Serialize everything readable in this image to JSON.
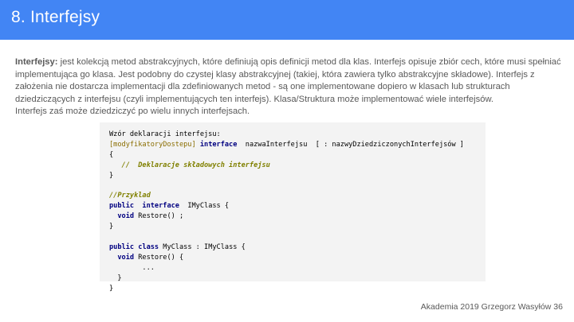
{
  "slide": {
    "title": "8. Interfejsy",
    "paragraph": {
      "term": "Interfejsy:",
      "line1": " jest kolekcją metod abstrakcyjnych, które definiują opis definicji metod dla klas. Interfejs opisuje zbiór cech, które musi spełniać",
      "line2": "implementująca go klasa. Jest podobny do czystej klasy abstrakcyjnej (takiej, która zawiera tylko abstrakcyjne składowe). Interfejs z",
      "line3": "założenia nie dostarcza implementacji dla zdefiniowanych metod - są one implementowane dopiero w klasach lub strukturach",
      "line4": "dziedziczących z interfejsu (czyli implementujących ten interfejs). Klasa/Struktura może implementować wiele interfejsów.",
      "line5": "Interfejs zaś może dziedziczyć po wielu innych interfejsach."
    },
    "code": {
      "l1": "Wzór deklaracji interfejsu:",
      "l2_mod": "[modyfikatoryDostepu]",
      "l2_kw": "interface",
      "l2_rest": "  nazwaInterfejsu  [ : nazwyDziedziczonychInterfejsów ]",
      "l3": "{",
      "l4_cmt": "   //  Deklaracje składowych interfejsu",
      "l5": "}",
      "l7_cmt": "//Przyklad",
      "l8_kw1": "public",
      "l8_kw2": "interface",
      "l8_rest": "  IMyClass {",
      "l9_kw": "void",
      "l9_rest": " Restore() ;",
      "l10": "}",
      "l12_kw1": "public",
      "l12_kw2": "class",
      "l12_rest": " MyClass : IMyClass {",
      "l13_kw": "void",
      "l13_rest": " Restore() {",
      "l14": "        ...",
      "l15": "  }",
      "l16": "}"
    },
    "footer": "Akademia 2019 Grzegorz Wasyłów 36"
  },
  "colors": {
    "title_bar": "#4285f4",
    "code_bg": "#f3f3f3",
    "keyword": "#000080",
    "modifier": "#8a6d00",
    "comment": "#808000"
  }
}
